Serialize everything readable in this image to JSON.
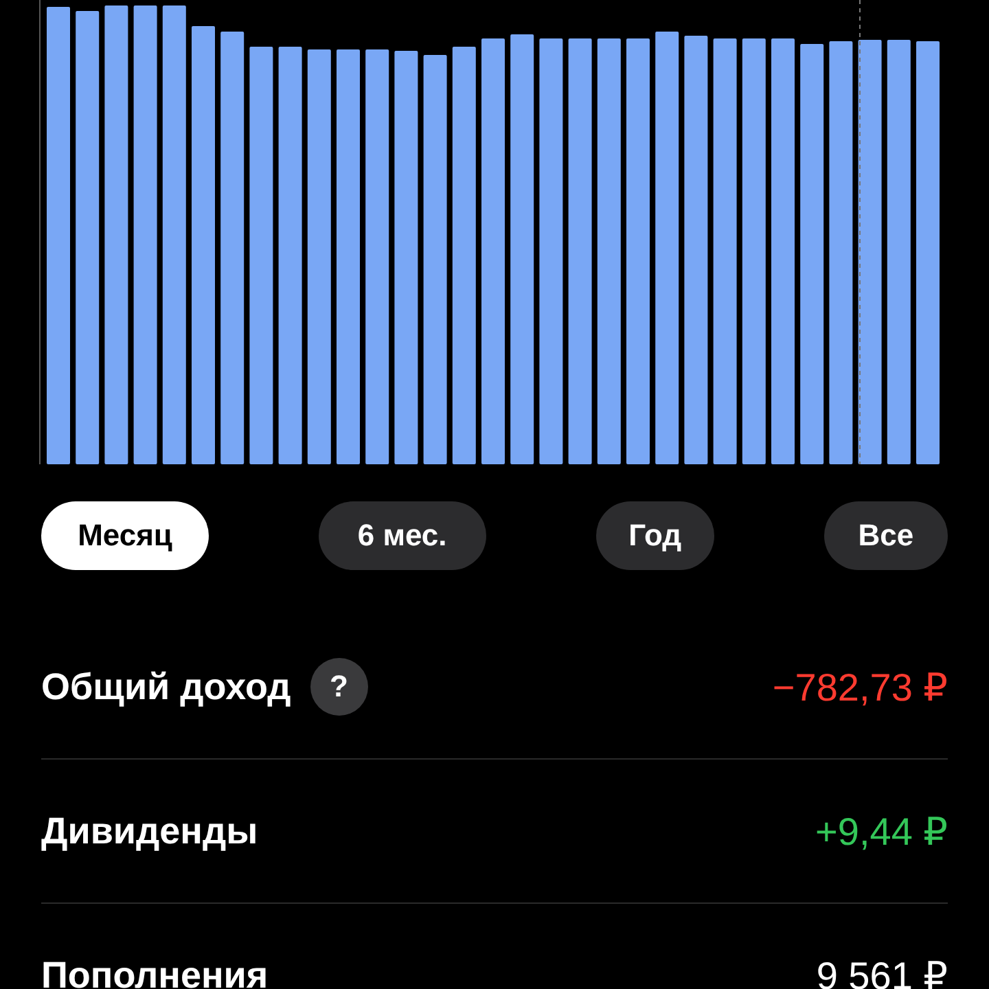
{
  "periods": [
    {
      "label": "Месяц",
      "selected": true
    },
    {
      "label": "6 мес.",
      "selected": false
    },
    {
      "label": "Год",
      "selected": false
    },
    {
      "label": "Все",
      "selected": false
    }
  ],
  "summary": [
    {
      "label": "Общий доход",
      "help": "?",
      "value": "−782,73 ₽",
      "color": "#ff3b30"
    },
    {
      "label": "Дивиденды",
      "value": "+9,44 ₽",
      "color": "#34c759"
    },
    {
      "label": "Пополнения",
      "value": "9 561 ₽",
      "color": "#ffffff"
    }
  ]
}
